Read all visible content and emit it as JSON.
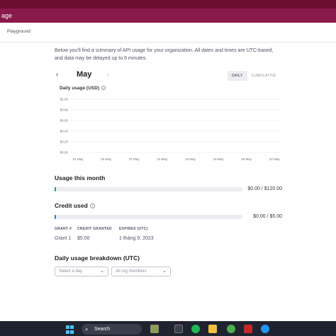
{
  "window": {
    "title_fragment": "age"
  },
  "nav": {
    "breadcrumb": "Playground"
  },
  "intro": {
    "line1": "Below you'll find a summary of API usage for your organization. All dates and times are UTC-based,",
    "line2": "and data may be delayed up to 5 minutes."
  },
  "month_nav": {
    "prev": "‹",
    "month": "May",
    "next": "›"
  },
  "view_toggle": {
    "daily": "DAILY",
    "cumulative": "CUMULATIVE",
    "selected": "DAILY"
  },
  "chart_data": {
    "type": "bar",
    "title": "Daily usage (USD)",
    "ylabel": "",
    "xlabel": "",
    "yticks": [
      "$1.00",
      "$0.80",
      "$0.60",
      "$0.40",
      "$0.20",
      "$0.00"
    ],
    "xticks": [
      "01 May",
      "04 May",
      "07 May",
      "10 May",
      "13 May",
      "16 May",
      "19 May",
      "22 May"
    ],
    "ylim": [
      0,
      1
    ],
    "series": [
      {
        "values": [
          0,
          0,
          0,
          0,
          0,
          0,
          0,
          0
        ]
      }
    ],
    "grid": true
  },
  "usage_this_month": {
    "title": "Usage this month",
    "value": "$0.00 / $120.00",
    "fraction": 0.0
  },
  "credit_used": {
    "title": "Credit used",
    "value": "$0.00 / $5.00",
    "fraction": 0.0
  },
  "grants": {
    "headers": [
      "GRANT #",
      "CREDIT GRANTED",
      "EXPIRES (UTC)"
    ],
    "rows": [
      [
        "Grant 1",
        "$5.00",
        "1 tháng 9, 2023"
      ]
    ]
  },
  "breakdown": {
    "title": "Daily usage breakdown (UTC)",
    "day_placeholder": "Select a day",
    "members_value": "All org members"
  },
  "taskbar": {
    "search_label": "Search"
  },
  "colors": {
    "brand": "#8a1a49",
    "accent": "#10a37f"
  }
}
